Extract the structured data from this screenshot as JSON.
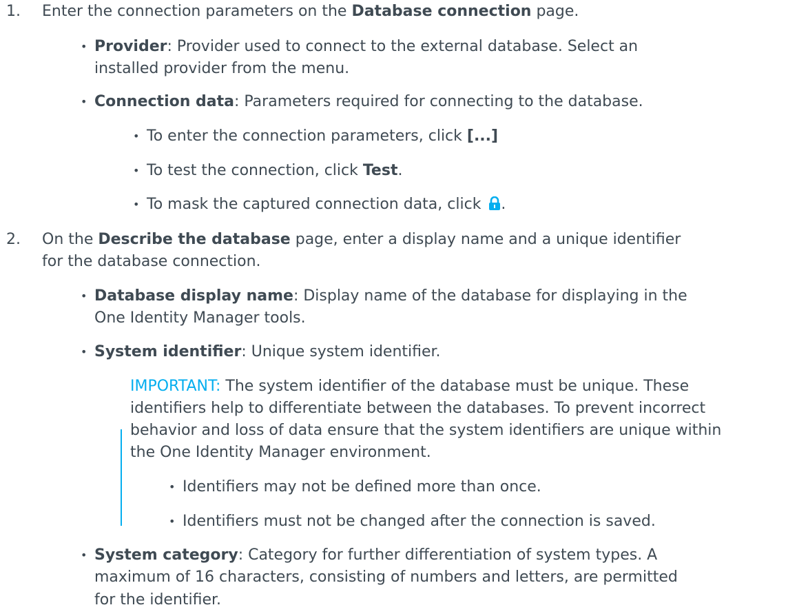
{
  "step1": {
    "number": "1.",
    "text_before": "Enter the connection parameters on the ",
    "bold": "Database connection",
    "text_after": " page.",
    "items": [
      {
        "term": "Provider",
        "desc_line1": ": Provider used to connect to the external database. Select an",
        "desc_line2": "installed provider from the menu."
      },
      {
        "term": "Connection data",
        "desc_line1": ": Parameters required for connecting to the database."
      }
    ],
    "sub_items": [
      {
        "text": "To enter the connection parameters, click ",
        "bold": "[...]",
        "after": ""
      },
      {
        "text": "To test the connection, click ",
        "bold": "Test",
        "after": "."
      },
      {
        "text": "To mask the captured connection data, click ",
        "icon": "lock-icon",
        "after": "."
      }
    ]
  },
  "step2": {
    "number": "2.",
    "text_before": "On the ",
    "bold": "Describe the database",
    "text_after_line1": " page, enter a display name and a unique identifier",
    "text_line2": "for the database connection.",
    "items": [
      {
        "term": "Database display name",
        "desc_line1": ": Display name of the database for displaying in the",
        "desc_line2": "One Identity Manager tools."
      },
      {
        "term": "System identifier",
        "desc_line1": ": Unique system identifier."
      },
      {
        "term": "System category",
        "desc_line1": ": Category for further differentiation of system types. A",
        "desc_line2": "maximum of 16 characters, consisting of numbers and letters, are permitted",
        "desc_line3": "for the identifier."
      }
    ],
    "note": {
      "label": "IMPORTANT:",
      "line1": " The system identifier of the database must be unique. These",
      "line2": "identifiers help to differentiate between the databases. To prevent incorrect",
      "line3": "behavior and loss of data ensure that the system identifiers are unique within",
      "line4": "the One Identity Manager environment.",
      "bullets": [
        "Identifiers may not be defined more than once.",
        "Identifiers must not be changed after the connection is saved."
      ]
    }
  },
  "bullet_char": "•",
  "colors": {
    "text": "#3f4a53",
    "accent": "#04aeef"
  }
}
